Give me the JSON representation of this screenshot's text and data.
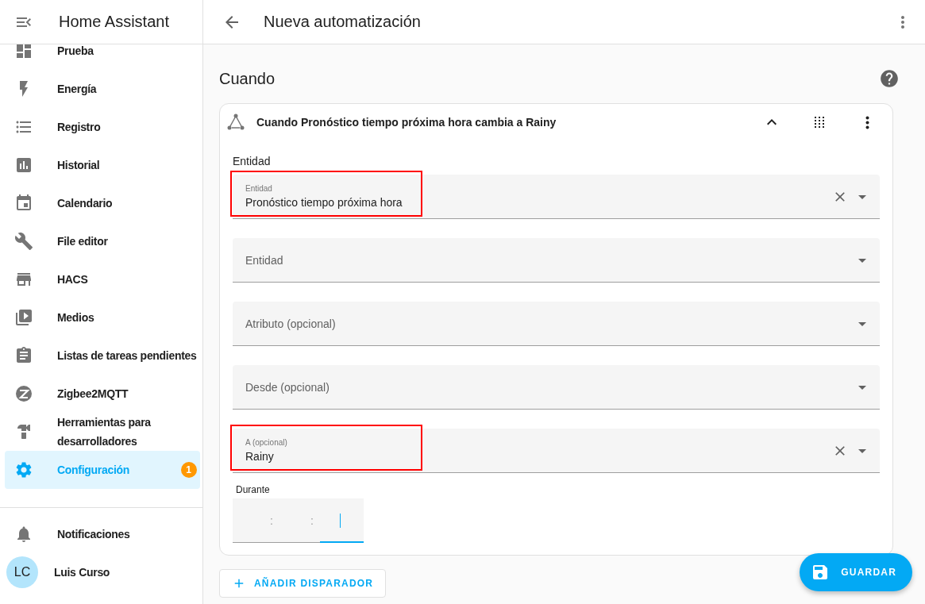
{
  "sidebar": {
    "title": "Home Assistant",
    "items": [
      {
        "label": "Prueba",
        "selected": false
      },
      {
        "label": "Energía",
        "selected": false
      },
      {
        "label": "Registro",
        "selected": false
      },
      {
        "label": "Historial",
        "selected": false
      },
      {
        "label": "Calendario",
        "selected": false
      },
      {
        "label": "File editor",
        "selected": false
      },
      {
        "label": "HACS",
        "selected": false
      },
      {
        "label": "Medios",
        "selected": false
      },
      {
        "label": "Listas de tareas pendientes",
        "selected": false
      },
      {
        "label": "Zigbee2MQTT",
        "selected": false
      },
      {
        "label": "Herramientas para desarrolladores",
        "selected": false
      },
      {
        "label": "Configuración",
        "selected": true,
        "badge": "1"
      }
    ],
    "notifications": "Notificaciones",
    "user": {
      "initials": "LC",
      "name": "Luis Curso"
    }
  },
  "header": {
    "title": "Nueva automatización"
  },
  "section": {
    "title": "Cuando"
  },
  "trigger": {
    "title": "Cuando Pronóstico tiempo próxima hora cambia a Rainy",
    "expanded": true,
    "entity_heading": "Entidad",
    "fields": [
      {
        "label": "Entidad",
        "value": "Pronóstico tiempo próxima hora",
        "clearable": true,
        "highlighted": true
      },
      {
        "label": "Entidad",
        "clearable": false,
        "highlighted": false
      },
      {
        "label": "Atributo (opcional)",
        "clearable": false,
        "highlighted": false
      },
      {
        "label": "Desde (opcional)",
        "clearable": false,
        "highlighted": false
      },
      {
        "label": "A (opcional)",
        "value": "Rainy",
        "clearable": true,
        "highlighted": true
      }
    ],
    "duration": {
      "label": "Durante",
      "separators": [
        ":",
        ":"
      ],
      "focused": true
    }
  },
  "add_button": "AÑADIR DISPARADOR",
  "save_button": "GUARDAR"
}
